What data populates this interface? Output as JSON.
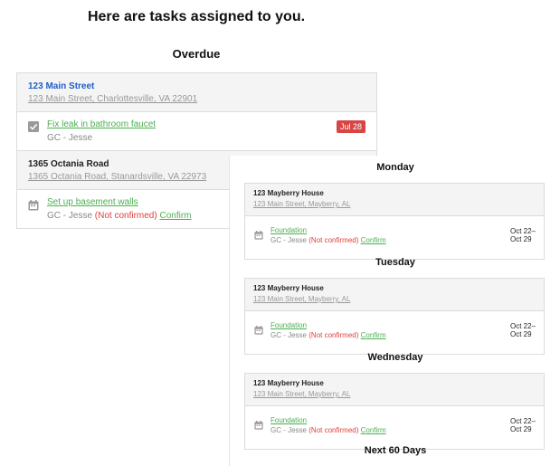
{
  "headline": "Here are tasks assigned to you.",
  "overdue": {
    "title": "Overdue",
    "properties": [
      {
        "name": "123 Main Street",
        "address": "123 Main Street, Charlottesville, VA 22901",
        "task": {
          "title": "Fix leak in bathroom faucet",
          "assignee": "GC - Jesse",
          "badge": "Jul 28",
          "icon": "checkbox-icon"
        }
      },
      {
        "name": "1365 Octania Road",
        "address": "1365 Octania Road, Stanardsville, VA 22973",
        "task": {
          "title": "Set up basement walls",
          "assignee": "GC - Jesse",
          "status": "(Not confirmed)",
          "confirm": "Confirm",
          "icon": "calendar-icon"
        }
      }
    ]
  },
  "days": [
    {
      "title": "Monday",
      "card": {
        "name": "123 Mayberry House",
        "address": "123 Main Street, Mayberry, AL",
        "task": "Foundation",
        "assignee": "GC - Jesse",
        "status": "(Not confirmed)",
        "confirm": "Confirm",
        "date_start": "Oct 22–",
        "date_end": "Oct 29"
      }
    },
    {
      "title": "Tuesday",
      "card": {
        "name": "123 Mayberry House",
        "address": "123 Main Street, Mayberry, AL",
        "task": "Foundation",
        "assignee": "GC - Jesse",
        "status": "(Not confirmed)",
        "confirm": "Confirm",
        "date_start": "Oct 22–",
        "date_end": "Oct 29"
      }
    },
    {
      "title": "Wednesday",
      "card": {
        "name": "123 Mayberry House",
        "address": "123 Main Street, Mayberry, AL",
        "task": "Foundation",
        "assignee": "GC - Jesse",
        "status": "(Not confirmed)",
        "confirm": "Confirm",
        "date_start": "Oct 22–",
        "date_end": "Oct 29"
      }
    }
  ],
  "next_section": "Next 60 Days",
  "colors": {
    "link_green": "#4caf50",
    "name_blue": "#1e5ec9",
    "not_confirmed_red": "#e0403b",
    "badge_red": "#d84545"
  }
}
